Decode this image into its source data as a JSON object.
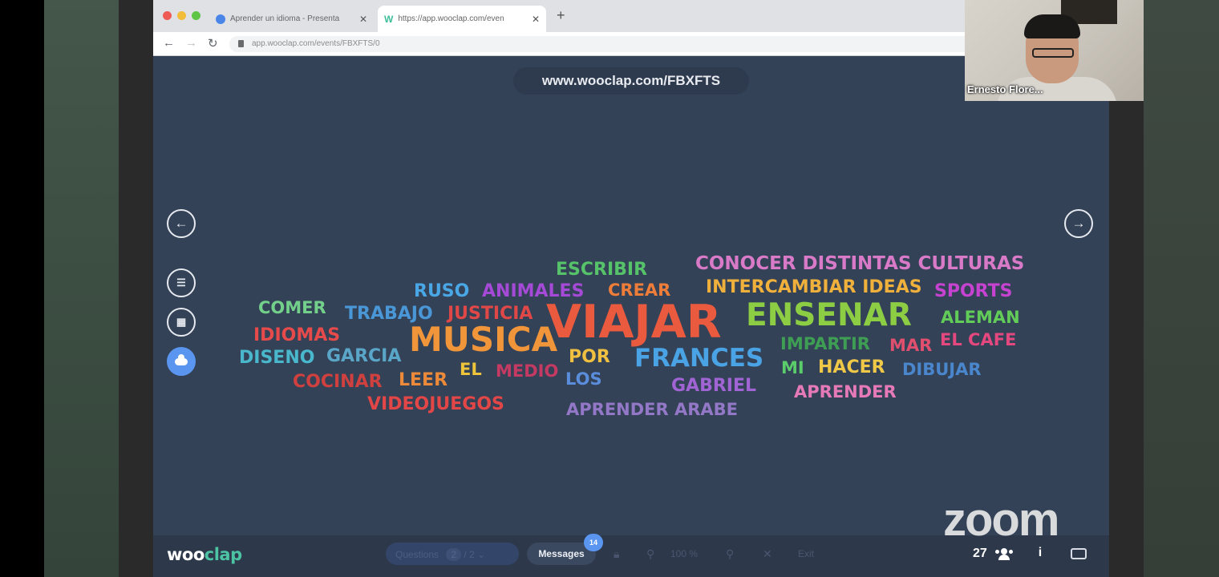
{
  "browser": {
    "tabs": [
      {
        "title": "Aprender un idioma - Presenta",
        "active": false
      },
      {
        "title": "https://app.wooclap.com/even",
        "active": true
      }
    ],
    "url": "app.wooclap.com/events/FBXFTS/0"
  },
  "join_url": "www.wooclap.com/FBXFTS",
  "word_cloud": [
    {
      "text": "CONOCER DISTINTAS CULTURAS",
      "color": "#d97ac8"
    },
    {
      "text": "ESCRIBIR",
      "color": "#56c26a"
    },
    {
      "text": "RUSO",
      "color": "#4aa7e6"
    },
    {
      "text": "ANIMALES",
      "color": "#a44ad6"
    },
    {
      "text": "CREAR",
      "color": "#ee7d3a"
    },
    {
      "text": "INTERCAMBIAR IDEAS",
      "color": "#f0b03c"
    },
    {
      "text": "SPORTS",
      "color": "#c642d0"
    },
    {
      "text": "COMER",
      "color": "#72d08a"
    },
    {
      "text": "TRABAJO",
      "color": "#4a97d8"
    },
    {
      "text": "JUSTICIA",
      "color": "#e04848"
    },
    {
      "text": "VIAJAR",
      "color": "#ea5a3e"
    },
    {
      "text": "ENSENAR",
      "color": "#8ccd44"
    },
    {
      "text": "ALEMAN",
      "color": "#62cc58"
    },
    {
      "text": "IDIOMAS",
      "color": "#e64a4a"
    },
    {
      "text": "MUSICA",
      "color": "#f0953a"
    },
    {
      "text": "EL CAFE",
      "color": "#e4487e"
    },
    {
      "text": "MAR",
      "color": "#e0506e"
    },
    {
      "text": "IMPARTIR",
      "color": "#3e9e54"
    },
    {
      "text": "DISENO",
      "color": "#4ab8cc"
    },
    {
      "text": "GARCIA",
      "color": "#5aa6c8"
    },
    {
      "text": "POR",
      "color": "#f0c040"
    },
    {
      "text": "FRANCES",
      "color": "#4aa3e4"
    },
    {
      "text": "EL",
      "color": "#eec43a"
    },
    {
      "text": "MEDIO",
      "color": "#c43a62"
    },
    {
      "text": "LOS",
      "color": "#5a8edc"
    },
    {
      "text": "MI",
      "color": "#5acc6a"
    },
    {
      "text": "HACER",
      "color": "#f0c848"
    },
    {
      "text": "DIBUJAR",
      "color": "#4a86cc"
    },
    {
      "text": "COCINAR",
      "color": "#d0403e"
    },
    {
      "text": "LEER",
      "color": "#ec8a3a"
    },
    {
      "text": "GABRIEL",
      "color": "#a064d4"
    },
    {
      "text": "APRENDER",
      "color": "#e67ab6"
    },
    {
      "text": "VIDEOJUEGOS",
      "color": "#e24646"
    },
    {
      "text": "APRENDER ARABE",
      "color": "#9478c8"
    }
  ],
  "bottom_bar": {
    "logo_a": "woo",
    "logo_b": "clap",
    "questions_label": "Questions",
    "questions_current": "2",
    "questions_sep": "/ 2",
    "messages_label": "Messages",
    "messages_badge": "14",
    "zoom_level": "100 %",
    "exit_label": "Exit",
    "participants": "27"
  },
  "watermark": "zoom",
  "video": {
    "name": "Ernesto Flore..."
  }
}
